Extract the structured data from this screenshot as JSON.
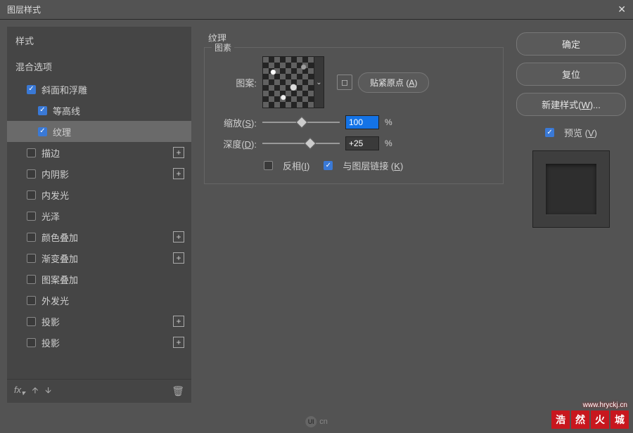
{
  "title": "图层样式",
  "left": {
    "header_styles": "样式",
    "header_blend": "混合选项",
    "items": [
      {
        "label": "斜面和浮雕",
        "checked": true,
        "indent": 1,
        "plus": false,
        "selected": false
      },
      {
        "label": "等高线",
        "checked": true,
        "indent": 2,
        "plus": false,
        "selected": false
      },
      {
        "label": "纹理",
        "checked": true,
        "indent": 2,
        "plus": false,
        "selected": true
      },
      {
        "label": "描边",
        "checked": false,
        "indent": 1,
        "plus": true,
        "selected": false
      },
      {
        "label": "内阴影",
        "checked": false,
        "indent": 1,
        "plus": true,
        "selected": false
      },
      {
        "label": "内发光",
        "checked": false,
        "indent": 1,
        "plus": false,
        "selected": false
      },
      {
        "label": "光泽",
        "checked": false,
        "indent": 1,
        "plus": false,
        "selected": false
      },
      {
        "label": "颜色叠加",
        "checked": false,
        "indent": 1,
        "plus": true,
        "selected": false
      },
      {
        "label": "渐变叠加",
        "checked": false,
        "indent": 1,
        "plus": true,
        "selected": false
      },
      {
        "label": "图案叠加",
        "checked": false,
        "indent": 1,
        "plus": false,
        "selected": false
      },
      {
        "label": "外发光",
        "checked": false,
        "indent": 1,
        "plus": false,
        "selected": false
      },
      {
        "label": "投影",
        "checked": false,
        "indent": 1,
        "plus": true,
        "selected": false
      },
      {
        "label": "投影",
        "checked": false,
        "indent": 1,
        "plus": true,
        "selected": false
      }
    ],
    "fx": "fx"
  },
  "center": {
    "section": "纹理",
    "group": "图素",
    "pattern_label": "图案:",
    "snap_button": "贴紧原点 (",
    "snap_key": "A",
    "snap_close": ")",
    "scale_label": "缩放(",
    "scale_key": "S",
    "scale_close": "):",
    "scale_value": "100",
    "depth_label": "深度(",
    "depth_key": "D",
    "depth_close": "):",
    "depth_value": "+25",
    "percent": "%",
    "invert_label": "反相(",
    "invert_key": "I",
    "invert_close": ")",
    "link_label": "与图层链接 (",
    "link_key": "K",
    "link_close": ")",
    "invert_checked": false,
    "link_checked": true
  },
  "right": {
    "ok": "确定",
    "reset": "复位",
    "new_style": "新建样式(",
    "new_style_key": "W",
    "new_style_close": ")...",
    "preview": "预览 (",
    "preview_key": "V",
    "preview_close": ")",
    "preview_checked": true
  },
  "footer": {
    "ui_cn": "cn",
    "watermark_url": "www.hryckj.cn",
    "wm1": "浩",
    "wm2": "然",
    "wm3": "火",
    "wm4": "城"
  }
}
